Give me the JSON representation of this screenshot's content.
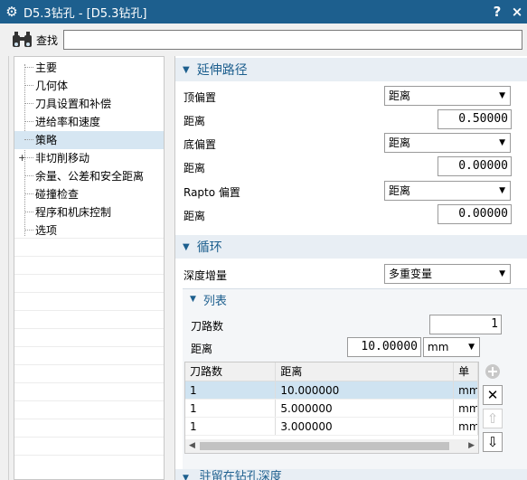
{
  "window": {
    "title": "D5.3钻孔 - [D5.3钻孔]",
    "help_label": "?",
    "close_label": "×"
  },
  "search": {
    "label": "查找",
    "value": ""
  },
  "nav": {
    "items": [
      {
        "label": "主要"
      },
      {
        "label": "几何体"
      },
      {
        "label": "刀具设置和补偿"
      },
      {
        "label": "进给率和速度"
      },
      {
        "label": "策略",
        "selected": true
      },
      {
        "label": "非切削移动",
        "expandable": true
      },
      {
        "label": "余量、公差和安全距离"
      },
      {
        "label": "碰撞检查"
      },
      {
        "label": "程序和机床控制"
      },
      {
        "label": "选项"
      }
    ],
    "expander_icon": "+"
  },
  "extend_path": {
    "title": "延伸路径",
    "top_offset_label": "顶偏置",
    "top_offset_select": "距离",
    "top_distance_label": "距离",
    "top_distance_value": "0.50000",
    "bottom_offset_label": "底偏置",
    "bottom_offset_select": "距离",
    "bottom_distance_label": "距离",
    "bottom_distance_value": "0.00000",
    "rapto_offset_label": "Rapto 偏置",
    "rapto_offset_select": "距离",
    "rapto_distance_label": "距离",
    "rapto_distance_value": "0.00000"
  },
  "cycle": {
    "title": "循环",
    "depth_increment_label": "深度增量",
    "depth_increment_select": "多重变量",
    "list": {
      "title": "列表",
      "passes_label": "刀路数",
      "passes_value": "1",
      "distance_label": "距离",
      "distance_value": "10.00000",
      "unit_select": "mm",
      "table": {
        "headers": [
          "刀路数",
          "距离",
          "单"
        ],
        "rows": [
          {
            "passes": "1",
            "distance": "10.000000",
            "unit": "mm",
            "selected": true
          },
          {
            "passes": "1",
            "distance": "5.000000",
            "unit": "mm"
          },
          {
            "passes": "1",
            "distance": "3.000000",
            "unit": "mm"
          }
        ]
      }
    }
  },
  "bottom_section": {
    "title": "驻留在钻孔深度"
  },
  "icons": {
    "gear": "gear-icon",
    "binoculars": "binoculars-icon",
    "add": "add-icon",
    "delete": "delete-icon",
    "move_up": "move-up-icon",
    "move_down": "move-down-icon"
  },
  "colors": {
    "titlebar": "#1d5f8e",
    "accent": "#1d5f8e",
    "selected_row": "#cfe3f1"
  }
}
